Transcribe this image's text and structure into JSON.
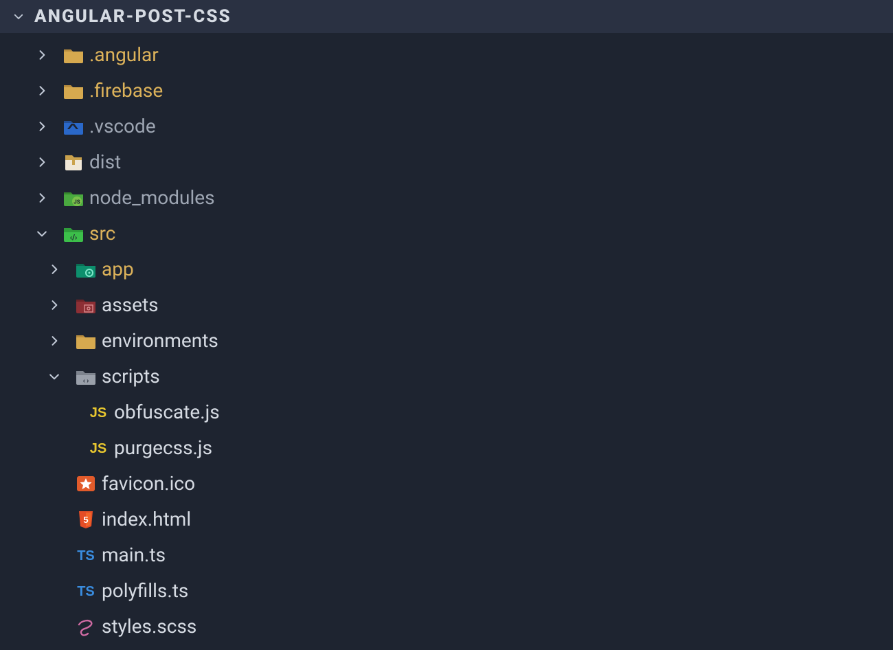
{
  "project": {
    "title": "ANGULAR-POST-CSS"
  },
  "tree": [
    {
      "depth": 0,
      "arrow": "right",
      "icon": "folder",
      "label": ".angular",
      "color": "gold"
    },
    {
      "depth": 0,
      "arrow": "right",
      "icon": "folder",
      "label": ".firebase",
      "color": "gold"
    },
    {
      "depth": 0,
      "arrow": "right",
      "icon": "folder-vscode",
      "label": ".vscode",
      "color": "gray"
    },
    {
      "depth": 0,
      "arrow": "right",
      "icon": "folder-dist",
      "label": "dist",
      "color": "gray"
    },
    {
      "depth": 0,
      "arrow": "right",
      "icon": "folder-node",
      "label": "node_modules",
      "color": "gray"
    },
    {
      "depth": 0,
      "arrow": "down",
      "icon": "folder-src",
      "label": "src",
      "color": "gold"
    },
    {
      "depth": 1,
      "arrow": "right",
      "icon": "folder-app",
      "label": "app",
      "color": "gold"
    },
    {
      "depth": 1,
      "arrow": "right",
      "icon": "folder-assets",
      "label": "assets",
      "color": "white"
    },
    {
      "depth": 1,
      "arrow": "right",
      "icon": "folder",
      "label": "environments",
      "color": "white"
    },
    {
      "depth": 1,
      "arrow": "down",
      "icon": "folder-scripts",
      "label": "scripts",
      "color": "white"
    },
    {
      "depth": 2,
      "arrow": "none",
      "icon": "js",
      "label": "obfuscate.js",
      "color": "white"
    },
    {
      "depth": 2,
      "arrow": "none",
      "icon": "js",
      "label": "purgecss.js",
      "color": "white"
    },
    {
      "depth": 1,
      "arrow": "none",
      "icon": "favicon",
      "label": "favicon.ico",
      "color": "white"
    },
    {
      "depth": 1,
      "arrow": "none",
      "icon": "html",
      "label": "index.html",
      "color": "white"
    },
    {
      "depth": 1,
      "arrow": "none",
      "icon": "ts",
      "label": "main.ts",
      "color": "white"
    },
    {
      "depth": 1,
      "arrow": "none",
      "icon": "ts",
      "label": "polyfills.ts",
      "color": "white"
    },
    {
      "depth": 1,
      "arrow": "none",
      "icon": "scss",
      "label": "styles.scss",
      "color": "white"
    }
  ]
}
